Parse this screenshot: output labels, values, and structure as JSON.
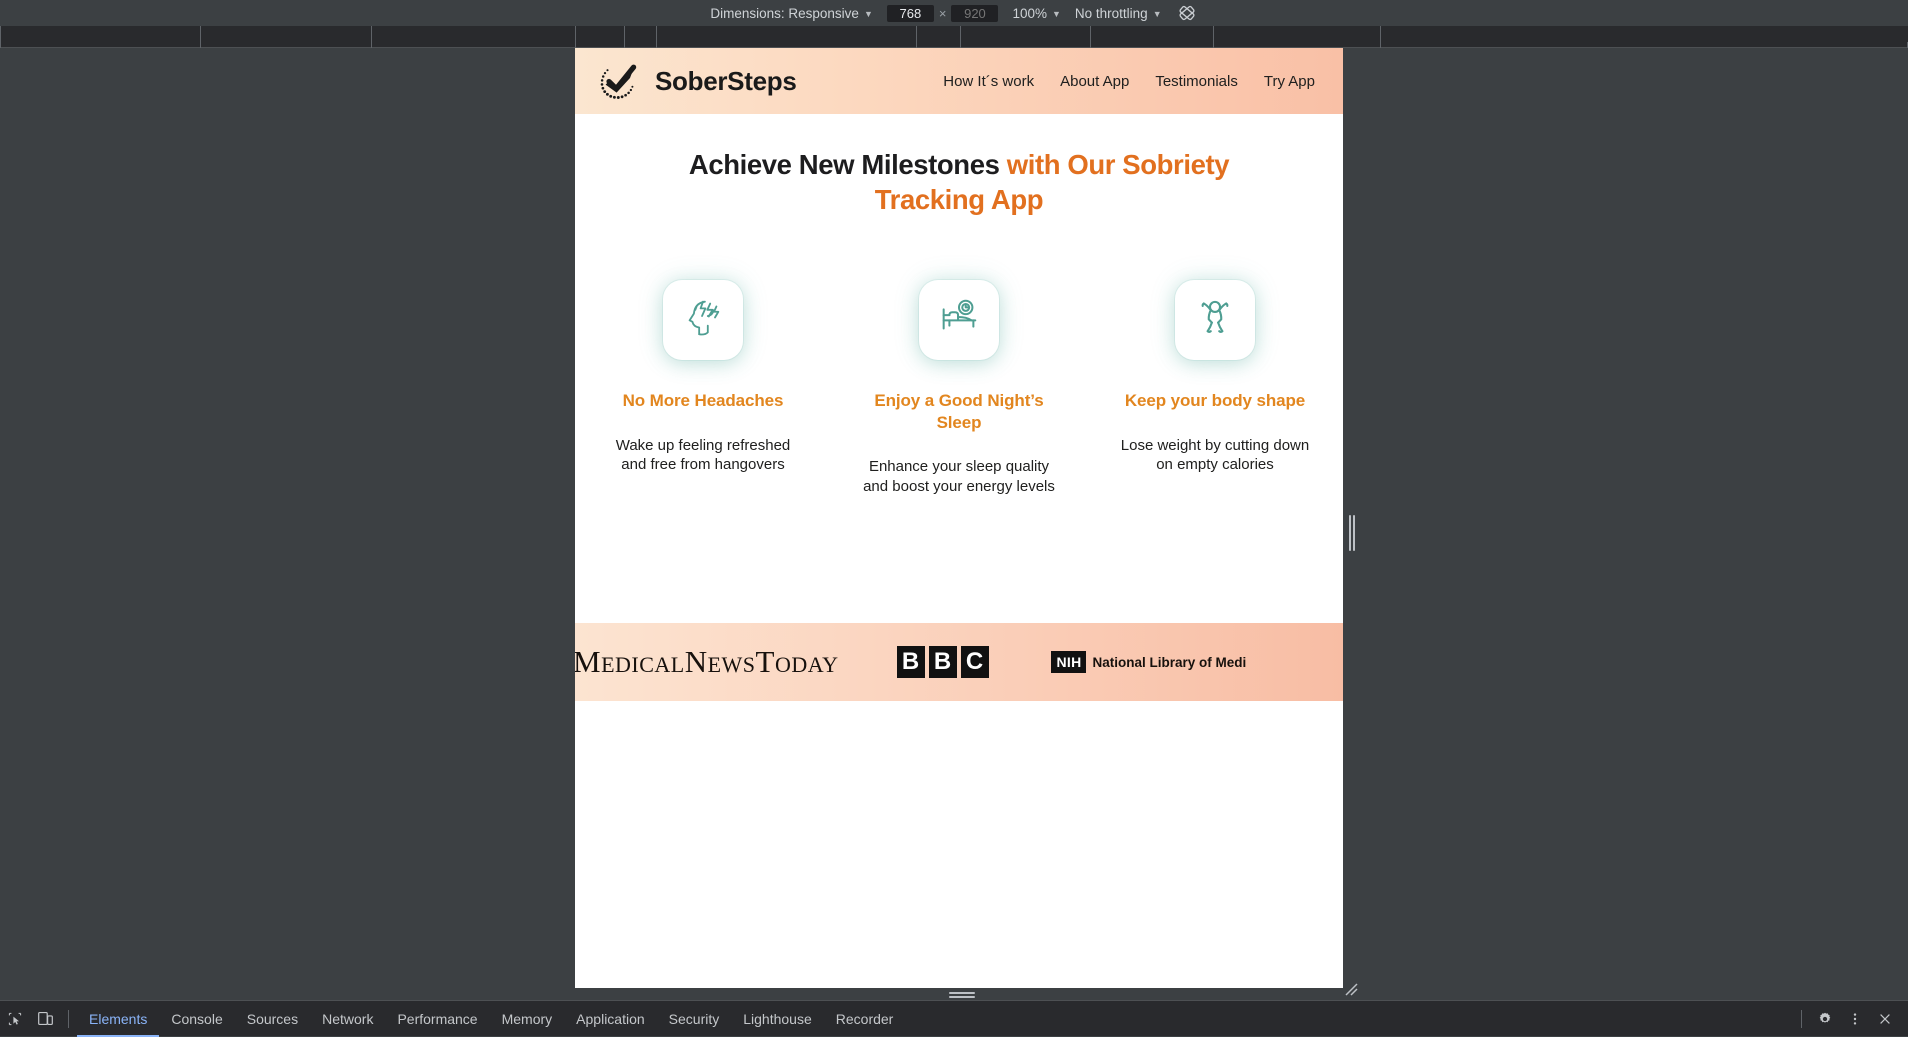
{
  "devtools": {
    "toolbar": {
      "dimensions_label": "Dimensions: Responsive",
      "width_value": "768",
      "height_value": "920",
      "height_placeholder": "920",
      "zoom_label": "100%",
      "throttling_label": "No throttling",
      "rotate_icon": "rotate-icon"
    },
    "panel_tabs": [
      {
        "label": "Elements",
        "active": true
      },
      {
        "label": "Console",
        "active": false
      },
      {
        "label": "Sources",
        "active": false
      },
      {
        "label": "Network",
        "active": false
      },
      {
        "label": "Performance",
        "active": false
      },
      {
        "label": "Memory",
        "active": false
      },
      {
        "label": "Application",
        "active": false
      },
      {
        "label": "Security",
        "active": false
      },
      {
        "label": "Lighthouse",
        "active": false
      },
      {
        "label": "Recorder",
        "active": false
      }
    ],
    "left_icons": [
      {
        "name": "inspect-element-icon"
      },
      {
        "name": "device-toolbar-icon"
      }
    ],
    "right_icons": [
      {
        "name": "gear-icon"
      },
      {
        "name": "more-options-icon"
      },
      {
        "name": "close-icon"
      }
    ]
  },
  "site": {
    "header": {
      "logo_icon": "checkmark-logo-icon",
      "brand_name": "SoberSteps",
      "nav": [
        {
          "label": "How It´s work"
        },
        {
          "label": "About App"
        },
        {
          "label": "Testimonials"
        },
        {
          "label": "Try App"
        }
      ]
    },
    "hero": {
      "title_plain": "Achieve New Milestones ",
      "title_accent": "with Our Sobriety Tracking App"
    },
    "features": [
      {
        "icon": "headache-head-lightning-icon",
        "title": "No More Headaches",
        "desc": "Wake up feeling refreshed and free from hangovers"
      },
      {
        "icon": "bed-clock-sleep-icon",
        "title": "Enjoy a Good Night’s Sleep",
        "desc": "Enhance your sleep quality and boost your energy levels"
      },
      {
        "icon": "person-arms-raised-icon",
        "title": "Keep your body shape",
        "desc": "Lose weight by cutting down on empty calories"
      }
    ],
    "press": {
      "medical_news_today": "MedicalNewsToday",
      "bbc_letters": [
        "B",
        "B",
        "C"
      ],
      "nih_badge": "NIH",
      "nih_text": "National Library of Medi"
    }
  },
  "colors": {
    "accent_orange": "#e2701f",
    "feature_title_orange": "#e2861f",
    "icon_teal": "#4e9e92",
    "header_gradient_start": "#fbe6d0",
    "header_gradient_end": "#f9c0a6",
    "devtools_bg": "#3c4043",
    "devtools_active_tab": "#8ab4f8"
  }
}
